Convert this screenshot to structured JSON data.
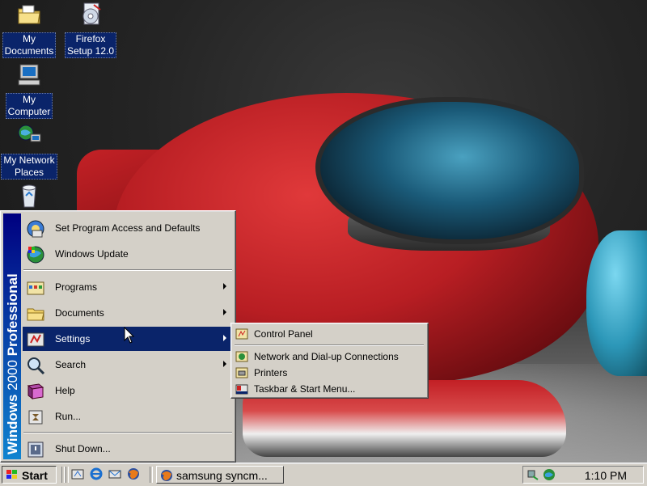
{
  "desktop": {
    "icons": [
      {
        "label_line1": "My",
        "label_line2": "Documents",
        "icon": "my-documents-icon"
      },
      {
        "label_line1": "Firefox",
        "label_line2": "Setup 12.0",
        "icon": "firefox-setup-icon"
      },
      {
        "label_line1": "My",
        "label_line2": "Computer",
        "icon": "my-computer-icon"
      },
      {
        "label_line1": "My Network",
        "label_line2": "Places",
        "icon": "network-places-icon"
      },
      {
        "icon": "recycle-bin-icon"
      }
    ]
  },
  "start_menu": {
    "banner_bold1": "Windows",
    "banner_thin": "2000",
    "banner_bold2": "Professional",
    "items": [
      {
        "label": "Set Program Access and Defaults",
        "icon": "program-access-icon",
        "submenu": false
      },
      {
        "label": "Windows Update",
        "icon": "windows-update-icon",
        "submenu": false
      },
      {
        "label": "Programs",
        "icon": "programs-icon",
        "submenu": true
      },
      {
        "label": "Documents",
        "icon": "documents-folder-icon",
        "submenu": true
      },
      {
        "label": "Settings",
        "icon": "settings-icon",
        "submenu": true,
        "active": true
      },
      {
        "label": "Search",
        "icon": "search-icon",
        "submenu": true
      },
      {
        "label": "Help",
        "icon": "help-icon",
        "submenu": false
      },
      {
        "label": "Run...",
        "icon": "run-icon",
        "submenu": false
      },
      {
        "label": "Shut Down...",
        "icon": "shutdown-icon",
        "submenu": false
      }
    ]
  },
  "settings_submenu": {
    "items": [
      {
        "label": "Control Panel",
        "icon": "control-panel-icon"
      },
      {
        "label": "Network and Dial-up Connections",
        "icon": "network-connections-icon"
      },
      {
        "label": "Printers",
        "icon": "printers-icon"
      },
      {
        "label": "Taskbar & Start Menu...",
        "icon": "taskbar-icon"
      }
    ]
  },
  "taskbar": {
    "start_label": "Start",
    "quick_launch": [
      "show-desktop-icon",
      "internet-explorer-icon",
      "outlook-express-icon",
      "firefox-icon"
    ],
    "task_button_label": "samsung syncm...",
    "clock": "1:10 PM"
  },
  "colors": {
    "highlight": "#0a246a",
    "face": "#d4d0c8",
    "banner_top": "#000080",
    "banner_bottom": "#1084d0"
  }
}
